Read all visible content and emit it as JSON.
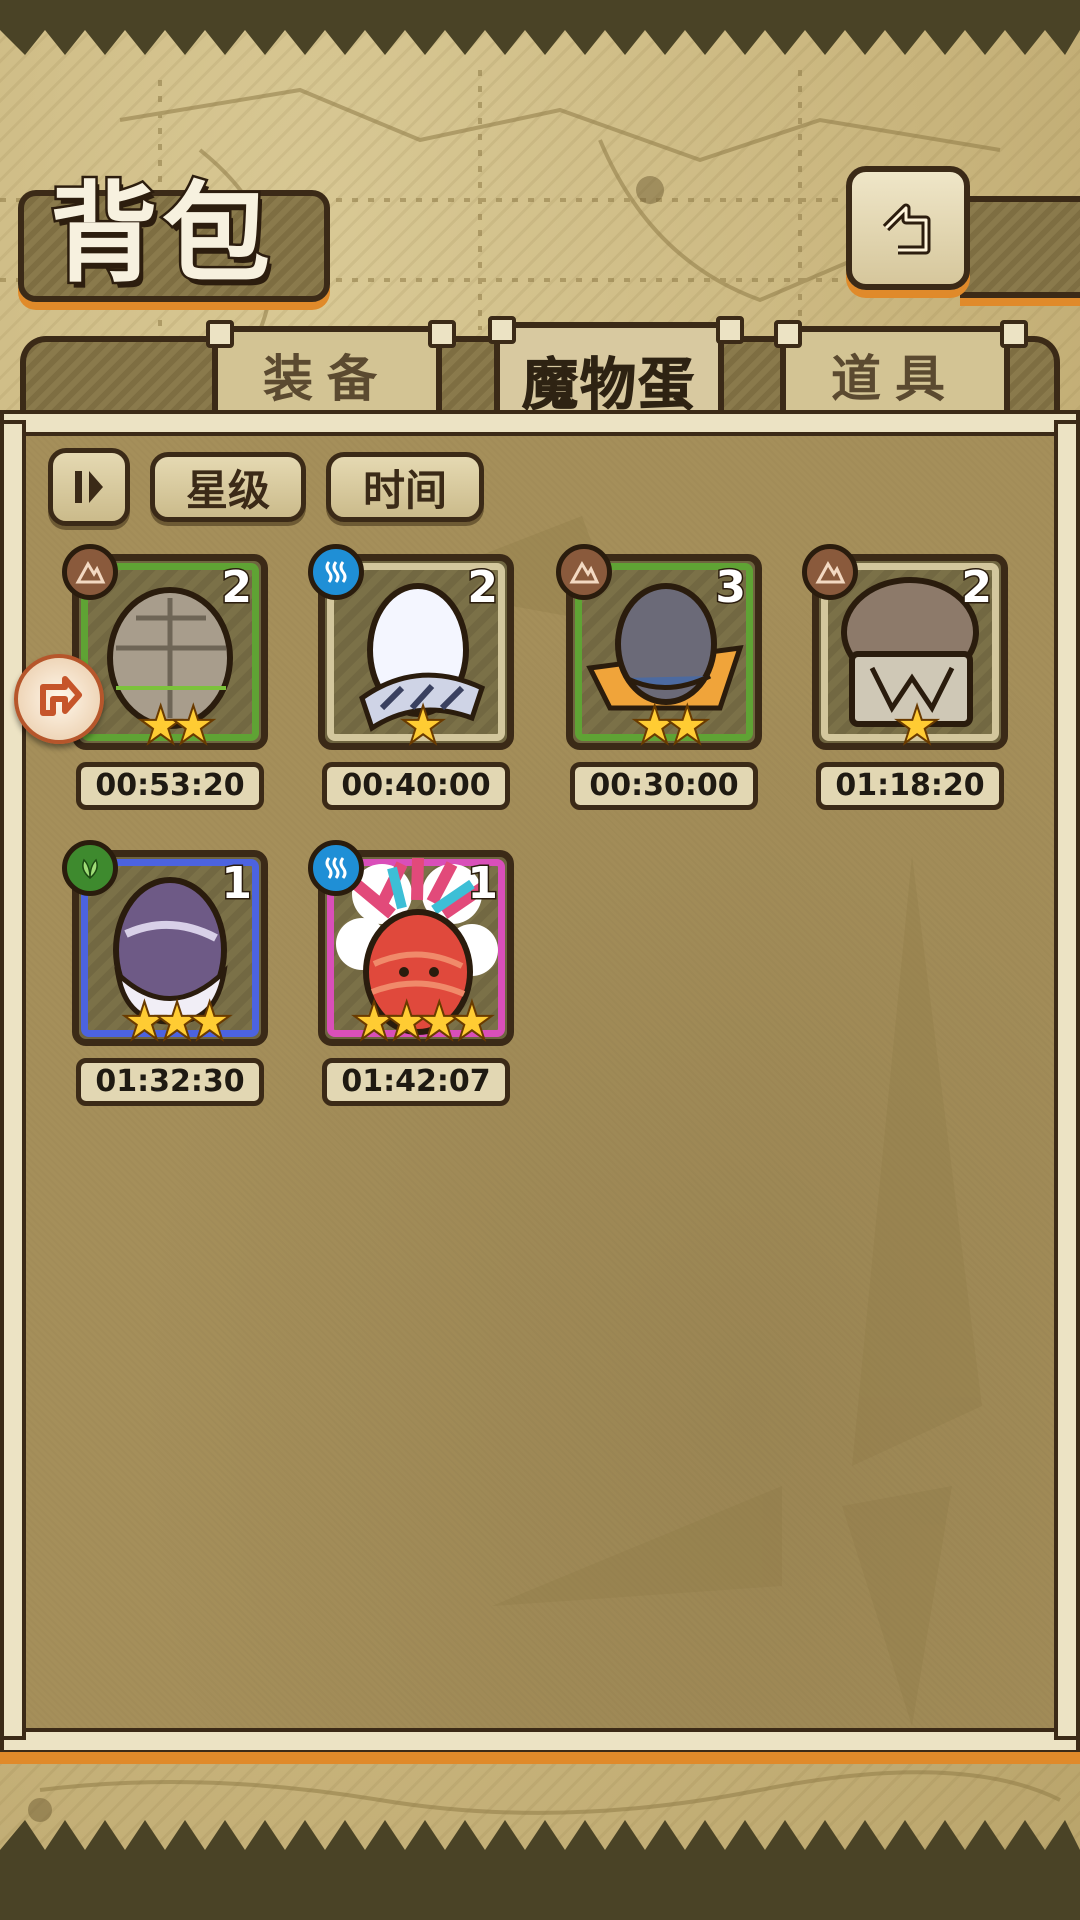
{
  "header": {
    "title": "背包",
    "back_icon": "back-arrow-icon"
  },
  "tabs": [
    {
      "label": "装备",
      "active": false
    },
    {
      "label": "魔物蛋",
      "active": true
    },
    {
      "label": "道具",
      "active": false
    }
  ],
  "sort_bar": {
    "toggle_icon": "sort-toggle-icon",
    "star_label": "星级",
    "time_label": "时间"
  },
  "side_badge_icon": "hatch-arrow-icon",
  "eggs": [
    {
      "element": "earth",
      "element_icon": "mountain-icon",
      "count": "2",
      "stars": 2,
      "timer": "00:53:20",
      "rarity_color": "#5fa334",
      "art": "stone-egg"
    },
    {
      "element": "water",
      "element_icon": "wave-icon",
      "count": "2",
      "stars": 1,
      "timer": "00:40:00",
      "rarity_color": "#d3c79d",
      "art": "white-egg"
    },
    {
      "element": "earth",
      "element_icon": "mountain-icon",
      "count": "3",
      "stars": 2,
      "timer": "00:30:00",
      "rarity_color": "#5fa334",
      "art": "grey-egg-orange-cloth"
    },
    {
      "element": "earth",
      "element_icon": "mountain-icon",
      "count": "2",
      "stars": 1,
      "timer": "01:18:20",
      "rarity_color": "#d3c79d",
      "art": "capsule-egg"
    },
    {
      "element": "nature",
      "element_icon": "leaf-icon",
      "count": "1",
      "stars": 3,
      "timer": "01:32:30",
      "rarity_color": "#4c63e0",
      "art": "purple-furry-egg"
    },
    {
      "element": "water",
      "element_icon": "wave-icon",
      "count": "1",
      "stars": 4,
      "timer": "01:42:07",
      "rarity_color": "#d94fb9",
      "art": "feather-red-egg"
    }
  ],
  "colors": {
    "frame": "#3b2a17",
    "accent": "#e08a2a",
    "earth": "#8a5a3c",
    "water": "#1f8fd6",
    "nature": "#3e8a2e"
  }
}
